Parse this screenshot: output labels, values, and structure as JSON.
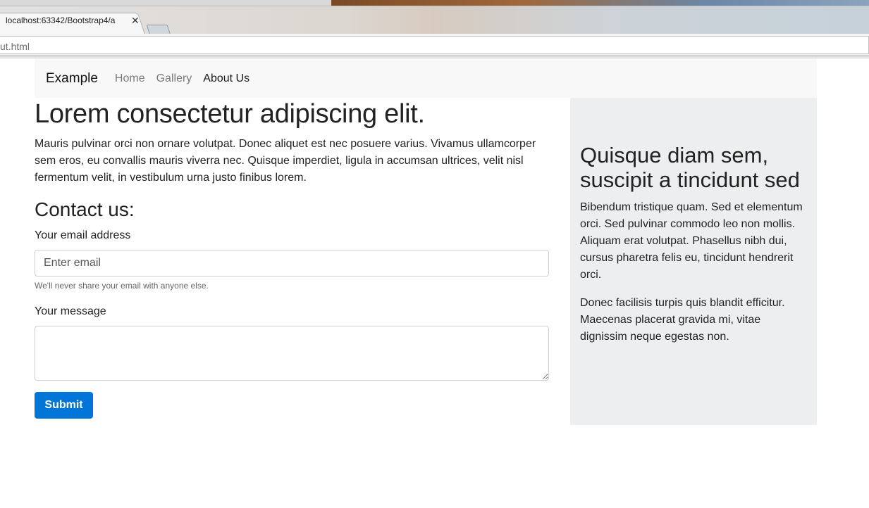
{
  "browser": {
    "tab_title": "localhost:63342/Bootstrap4/a",
    "tab_close": "✕",
    "url_fragment": "ut.html"
  },
  "navbar": {
    "brand": "Example",
    "links": [
      "Home",
      "Gallery",
      "About Us"
    ],
    "active": "About Us"
  },
  "main": {
    "headline": "Lorem consectetur adipiscing elit.",
    "intro": "Mauris pulvinar orci non ornare volutpat. Donec aliquet est nec posuere varius. Vivamus ullamcorper sem eros, eu convallis mauris viverra nec. Quisque imperdiet, ligula in accumsan ultrices, velit nisl fermentum velit, in vestibulum urna justo finibus lorem.",
    "contact_heading": "Contact us:",
    "email_label": "Your email address",
    "email_placeholder": "Enter email",
    "email_value": "",
    "email_help": "We'll never share your email with anyone else.",
    "message_label": "Your message",
    "message_value": "",
    "submit_label": "Submit"
  },
  "sidebar": {
    "title": "Quisque diam sem, suscipit a tincidunt sed",
    "paragraphs": [
      "Bibendum tristique quam. Sed et elementum orci. Sed pulvinar commodo leo non mollis. Aliquam erat volutpat. Phasellus nibh dui, cursus pharetra felis eu, tincidunt hendrerit orci.",
      "Donec facilisis turpis quis blandit efficitur. Maecenas placerat gravida mi, vitae dignissim neque egestas non."
    ]
  },
  "colors": {
    "primary": "#0275d8",
    "navbar_bg": "#f8f8f8",
    "sidebar_bg": "#eceeef"
  }
}
